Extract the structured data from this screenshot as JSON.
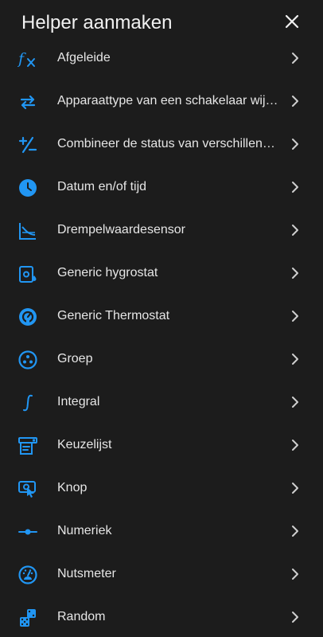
{
  "dialog": {
    "title": "Helper aanmaken",
    "close_icon": "close-icon"
  },
  "colors": {
    "background": "#1c1c1c",
    "accent": "#2196f3",
    "text": "#e6e6e6",
    "chevron": "#cfcfcf"
  },
  "items": [
    {
      "label": "Afgeleide",
      "icon": "function-icon"
    },
    {
      "label": "Apparaattype van een schakelaar wijzigen",
      "icon": "swap-arrows-icon"
    },
    {
      "label": "Combineer de status van verschillende sensoren",
      "icon": "plus-minus-icon"
    },
    {
      "label": "Datum en/of tijd",
      "icon": "clock-icon"
    },
    {
      "label": "Drempelwaardesensor",
      "icon": "threshold-chart-icon"
    },
    {
      "label": "Generic hygrostat",
      "icon": "hygrostat-icon"
    },
    {
      "label": "Generic Thermostat",
      "icon": "thermostat-icon"
    },
    {
      "label": "Groep",
      "icon": "group-icon"
    },
    {
      "label": "Integral",
      "icon": "integral-icon"
    },
    {
      "label": "Keuzelijst",
      "icon": "select-list-icon"
    },
    {
      "label": "Knop",
      "icon": "button-press-icon"
    },
    {
      "label": "Numeriek",
      "icon": "numeric-slider-icon"
    },
    {
      "label": "Nutsmeter",
      "icon": "gauge-icon"
    },
    {
      "label": "Random",
      "icon": "dice-icon"
    }
  ]
}
